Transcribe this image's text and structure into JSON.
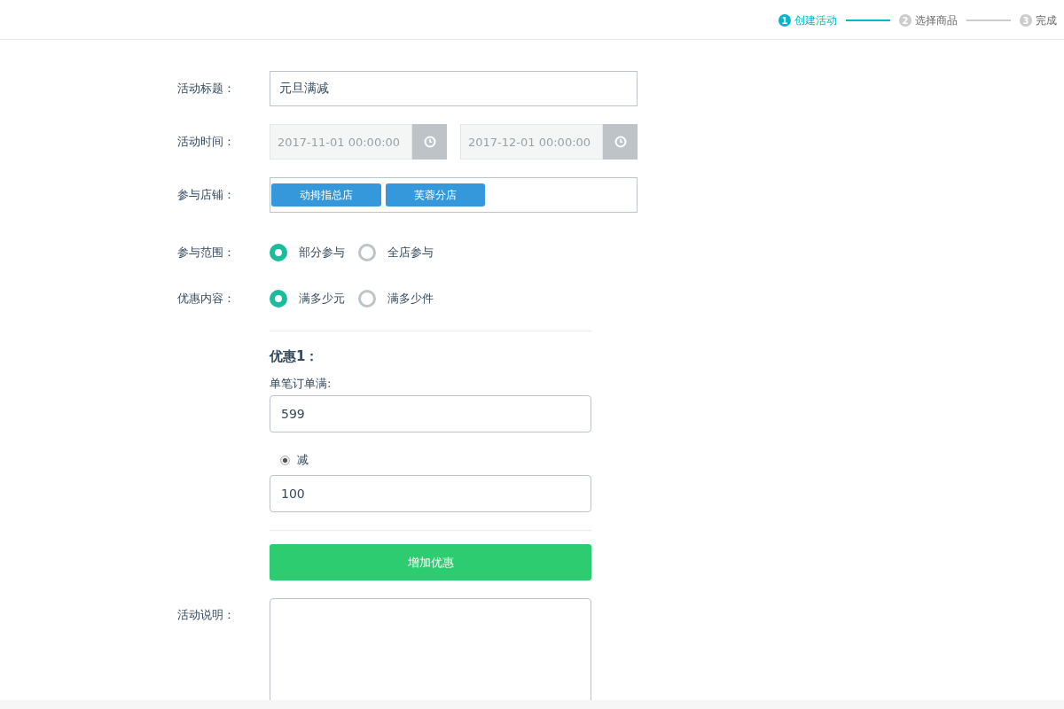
{
  "steps": [
    {
      "number": "1",
      "label": "创建活动",
      "selected": true
    },
    {
      "number": "2",
      "label": "选择商品",
      "selected": false
    },
    {
      "number": "3",
      "label": "完成",
      "selected": false
    }
  ],
  "title_row": {
    "label": "活动标题：",
    "value": "元旦满减"
  },
  "time_row": {
    "label": "活动时间：",
    "start": {
      "value": "2017-11-01 00:00:00",
      "disabled": true
    },
    "end": {
      "value": "2017-12-01 00:00:00",
      "disabled": true
    }
  },
  "stores_row": {
    "label": "参与店铺：",
    "tags": [
      "动拇指总店",
      "芙蓉分店"
    ]
  },
  "scope_row": {
    "label": "参与范围：",
    "options": [
      {
        "label": "部分参与",
        "selected": true
      },
      {
        "label": "全店参与",
        "selected": false
      }
    ]
  },
  "content_row": {
    "label": "优惠内容：",
    "options": [
      {
        "label": "满多少元",
        "selected": true
      },
      {
        "label": "满多少件",
        "selected": false
      }
    ]
  },
  "discounts": [
    {
      "title": "优惠1：",
      "threshold_label": "单笔订单满:",
      "threshold_value": "599",
      "reduce": {
        "label": "减",
        "selected": true
      },
      "reduce_value": "100"
    }
  ],
  "add_button": "增加优惠",
  "description_row": {
    "label": "活动说明："
  }
}
